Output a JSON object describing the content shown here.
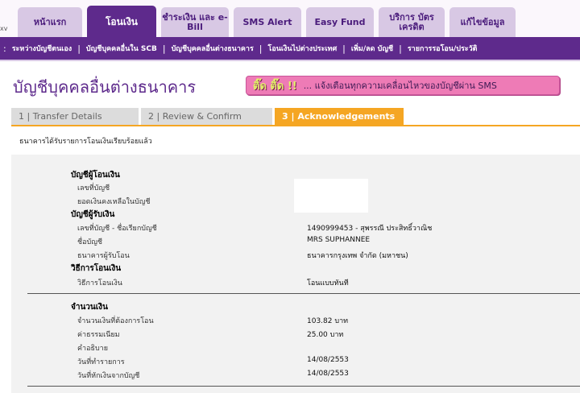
{
  "corner_label": "xv",
  "main_tabs": [
    {
      "label": "หน้าแรก",
      "active": false
    },
    {
      "label": "โอนเงิน",
      "active": true
    },
    {
      "label": "ชำระเงิน และ e-Bill",
      "active": false
    },
    {
      "label": "SMS Alert",
      "active": false
    },
    {
      "label": "Easy Fund",
      "active": false
    },
    {
      "label": "บริการ บัตรเครดิต",
      "active": false
    },
    {
      "label": "แก้ไขข้อมูล",
      "active": false
    }
  ],
  "sub_nav": [
    "ระหว่างบัญชีตนเอง",
    "บัญชีบุคคลอื่นใน SCB",
    "บัญชีบุคคลอื่นต่างธนาคาร",
    "โอนเงินไปต่างประเทศ",
    "เพิ่ม/ลด บัญชี",
    "รายการรอโอน/ประวัติ"
  ],
  "page_title": "บัญชีบุคคลอื่นต่างธนาคาร",
  "sms_banner": {
    "tid": "ติ๊ด ติ๊ด !!",
    "message": "... แจ้งเตือนทุกความเคลื่อนไหวของบัญชีผ่าน SMS"
  },
  "steps": [
    "1 | Transfer Details",
    "2 | Review & Confirm",
    "3 | Acknowledgements"
  ],
  "active_step": 3,
  "success_message": "ธนาคารได้รับรายการโอนเงินเรียบร้อยแล้ว",
  "from_account": {
    "heading": "บัญชีผู้โอนเงิน",
    "account_no_label": "เลขที่บัญชี",
    "balance_label": "ยอดเงินคงเหลือในบัญชี"
  },
  "to_account": {
    "heading": "บัญชีผู้รับเงิน",
    "account_no_label": "เลขที่บัญชี - ชื่อเรียกบัญชี",
    "account_no_value": "1490999453 - สุพรรณี ประสิทธิ์วาณิช",
    "name_label": "ชื่อบัญชี",
    "name_value": "MRS SUPHANNEE",
    "bank_label": "ธนาคารผู้รับโอน",
    "bank_value": "ธนาคารกรุงเทพ จำกัด (มหาชน)"
  },
  "method": {
    "heading": "วิธีการโอนเงิน",
    "label": "วิธีการโอนเงิน",
    "value": "โอนแบบทันที"
  },
  "amount": {
    "heading": "จำนวนเงิน",
    "amount_label": "จำนวนเงินที่ต้องการโอน",
    "amount_value": "103.82 บาท",
    "fee_label": "ค่าธรรมเนียม",
    "fee_value": "25.00 บาท",
    "desc_label": "คำอธิบาย",
    "txn_date_label": "วันที่ทำรายการ",
    "txn_date_value": "14/08/2553",
    "debit_date_label": "วันที่หักเงินจากบัญชี",
    "debit_date_value": "14/08/2553"
  },
  "colors": {
    "brand_purple": "#5e2a8c",
    "tab_inactive": "#d8c8e4",
    "step_active": "#f5a623",
    "banner_pink": "#ee7bb6"
  }
}
